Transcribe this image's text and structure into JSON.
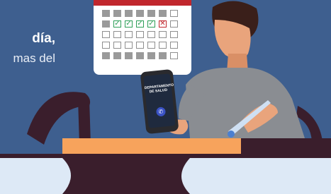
{
  "text": {
    "line1": "día,",
    "line2": "mas del"
  },
  "phone": {
    "label": "DEPARTAMENTO DE SALUD",
    "call_icon": "phone-icon"
  },
  "calendar": {
    "rows": [
      [
        "gray",
        "gray",
        "gray",
        "gray",
        "gray",
        "gray",
        "empty"
      ],
      [
        "gray",
        "check",
        "check",
        "check",
        "check",
        "x",
        "empty"
      ],
      [
        "empty",
        "empty",
        "empty",
        "empty",
        "empty",
        "empty",
        "empty"
      ],
      [
        "empty",
        "empty",
        "empty",
        "empty",
        "empty",
        "empty",
        "empty"
      ],
      [
        "gray",
        "gray",
        "gray",
        "gray",
        "gray",
        "gray",
        "empty"
      ]
    ]
  },
  "colors": {
    "background": "#3e5f8f",
    "shirt": "#8a8d92",
    "skin": "#e9a47c",
    "hair": "#3a1f1a",
    "table_top": "#f7a35c",
    "table_dark": "#3a1e2c",
    "calendar_red": "#c1272d",
    "check_green": "#2e9f58"
  }
}
